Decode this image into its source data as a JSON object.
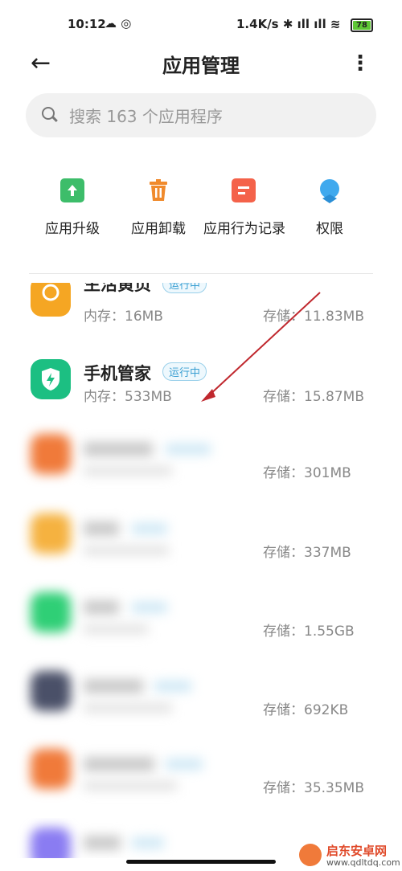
{
  "status_bar": {
    "time": "10:12",
    "left_icons": "☁ ◎",
    "speed": "1.4K/s",
    "right_icons": "✱ ıll ıll ≋",
    "battery": "78"
  },
  "header": {
    "title": "应用管理",
    "back_icon": "←",
    "more_icon": "⋮"
  },
  "search": {
    "placeholder": "搜索 163 个应用程序"
  },
  "actions": [
    {
      "label": "应用升级",
      "color": "#3dbd6a"
    },
    {
      "label": "应用卸载",
      "color": "#f08a2c"
    },
    {
      "label": "应用行为记录",
      "color": "#f4624a"
    },
    {
      "label": "权限",
      "color": "#3fa9ee"
    }
  ],
  "apps": [
    {
      "name": "生活黄页",
      "badge": "运行中",
      "memory": "内存：16MB",
      "storage": "存储：11.83MB",
      "color": "#f5a623"
    },
    {
      "name": "手机管家",
      "badge": "运行中",
      "memory": "内存：533MB",
      "storage": "存储：15.87MB",
      "color": "#1cbf82"
    },
    {
      "name": "",
      "badge": "",
      "memory": "",
      "storage": "存储：301MB",
      "color": "#f07a3a"
    },
    {
      "name": "",
      "badge": "",
      "memory": "",
      "storage": "存储：337MB",
      "color": "#f5b240"
    },
    {
      "name": "",
      "badge": "",
      "memory": "",
      "storage": "存储：1.55GB",
      "color": "#2fcf76"
    },
    {
      "name": "",
      "badge": "",
      "memory": "",
      "storage": "存储：692KB",
      "color": "#4a5068"
    },
    {
      "name": "",
      "badge": "",
      "memory": "",
      "storage": "存储：35.35MB",
      "color": "#f07a3a"
    },
    {
      "name": "",
      "badge": "",
      "memory": "",
      "storage": "",
      "color": "#8a7cf2"
    }
  ],
  "watermark": {
    "brand": "启东安卓网",
    "url": "www.qdltdq.com"
  }
}
